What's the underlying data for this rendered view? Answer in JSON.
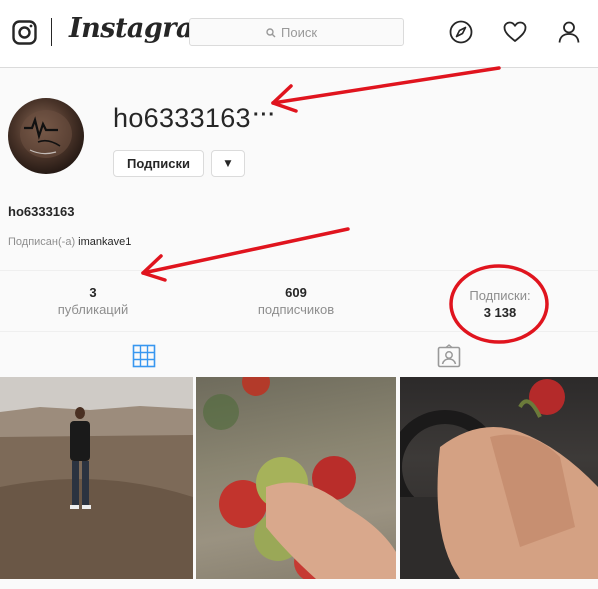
{
  "topbar": {
    "wordmark": "Instagram",
    "search_placeholder": "Поиск",
    "icons": [
      "instagram-glyph-icon",
      "compass-icon",
      "heart-icon",
      "person-icon"
    ]
  },
  "profile": {
    "username": "ho6333163",
    "more_label": "···",
    "follow_button_label": "Подписки",
    "dropdown_label": "▼",
    "full_name": "ho6333163",
    "followed_by_prefix": "Подписан(-а)",
    "followed_by_user": "imankave1"
  },
  "stats": [
    {
      "value": "3",
      "label": "публикаций"
    },
    {
      "value": "609",
      "label": "подписчиков"
    },
    {
      "value": "3 138",
      "label": "Подписки:"
    }
  ],
  "tabs": [
    {
      "icon": "grid-icon",
      "active": true
    },
    {
      "icon": "tagged-icon",
      "active": false
    }
  ],
  "colors": {
    "accent_blue": "#3897f0",
    "annotation_red": "#e0141e",
    "text": "#262626",
    "muted": "#8e8e8e",
    "border": "#dbdbdb"
  }
}
